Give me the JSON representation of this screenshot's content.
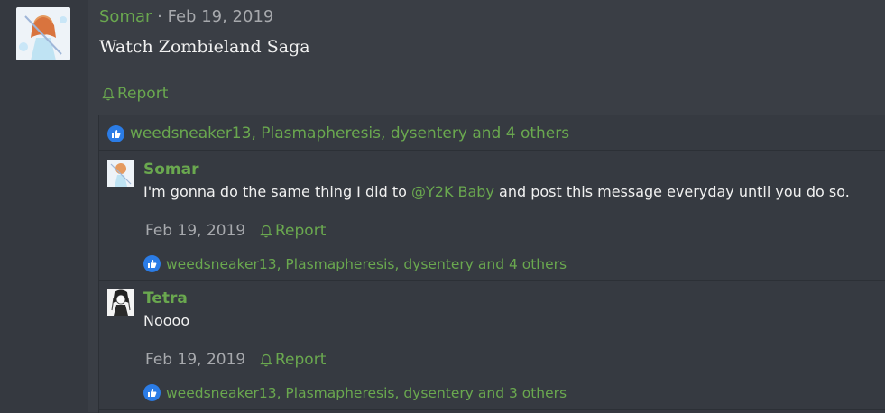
{
  "post": {
    "author": "Somar",
    "separator": "·",
    "date": "Feb 19, 2019",
    "body": "Watch Zombieland Saga",
    "report_label": "Report",
    "reactions_text": "weedsneaker13, Plasmapheresis, dysentery and 4 others"
  },
  "comments": [
    {
      "author": "Somar",
      "text_before": "I'm gonna do the same thing I did to ",
      "mention": "@Y2K Baby",
      "text_after": " and post this message everyday until you do so.",
      "date": "Feb 19, 2019",
      "report_label": "Report",
      "reactions_text": "weedsneaker13, Plasmapheresis, dysentery and 4 others"
    },
    {
      "author": "Tetra",
      "text": "Noooo",
      "date": "Feb 19, 2019",
      "report_label": "Report",
      "reactions_text": "weedsneaker13, Plasmapheresis, dysentery and 3 others"
    }
  ],
  "icons": {
    "report": "bell-icon",
    "reaction": "thumbs-up-icon"
  },
  "colors": {
    "accent": "#6aa84f",
    "like": "#2b7ce6",
    "background": "#3a3e45"
  }
}
